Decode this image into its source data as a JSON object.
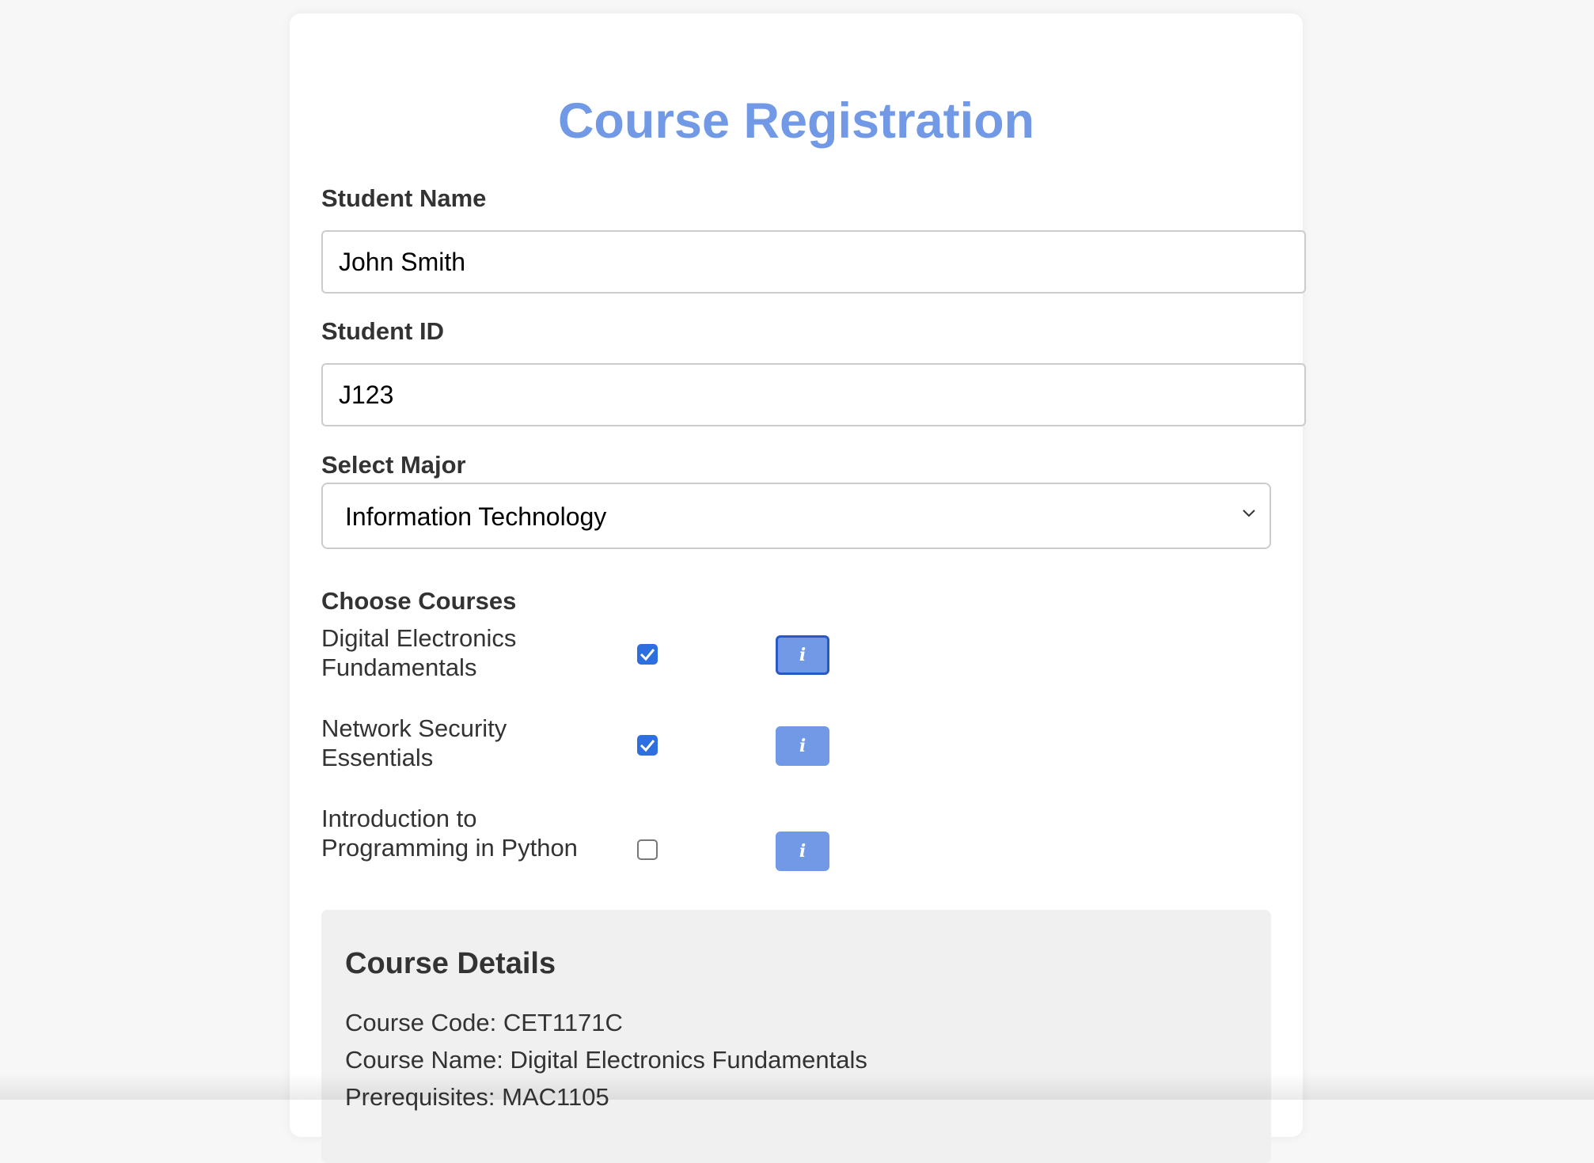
{
  "page": {
    "title": "Course Registration"
  },
  "form": {
    "student_name": {
      "label": "Student Name",
      "value": "John Smith"
    },
    "student_id": {
      "label": "Student ID",
      "value": "J123"
    },
    "major": {
      "label": "Select Major",
      "selected": "Information Technology"
    },
    "courses": {
      "label": "Choose Courses",
      "items": [
        {
          "name": "Digital Electronics Fundamentals",
          "checked": true,
          "info_label": "i"
        },
        {
          "name": "Network Security Essentials",
          "checked": true,
          "info_label": "i"
        },
        {
          "name": "Introduction to Programming in Python",
          "checked": false,
          "info_label": "i"
        }
      ]
    }
  },
  "details": {
    "heading": "Course Details",
    "lines": [
      "Course Code: CET1171C",
      "Course Name: Digital Electronics Fundamentals",
      "Prerequisites: MAC1105"
    ]
  },
  "colors": {
    "accent": "#7199e6",
    "checkbox": "#2e6fe0",
    "focus_ring": "#2a58c4",
    "details_background": "#f0f0f0"
  },
  "icons": {
    "dropdown": "chevron-down-icon",
    "info": "info-icon",
    "check": "checkmark-icon"
  }
}
